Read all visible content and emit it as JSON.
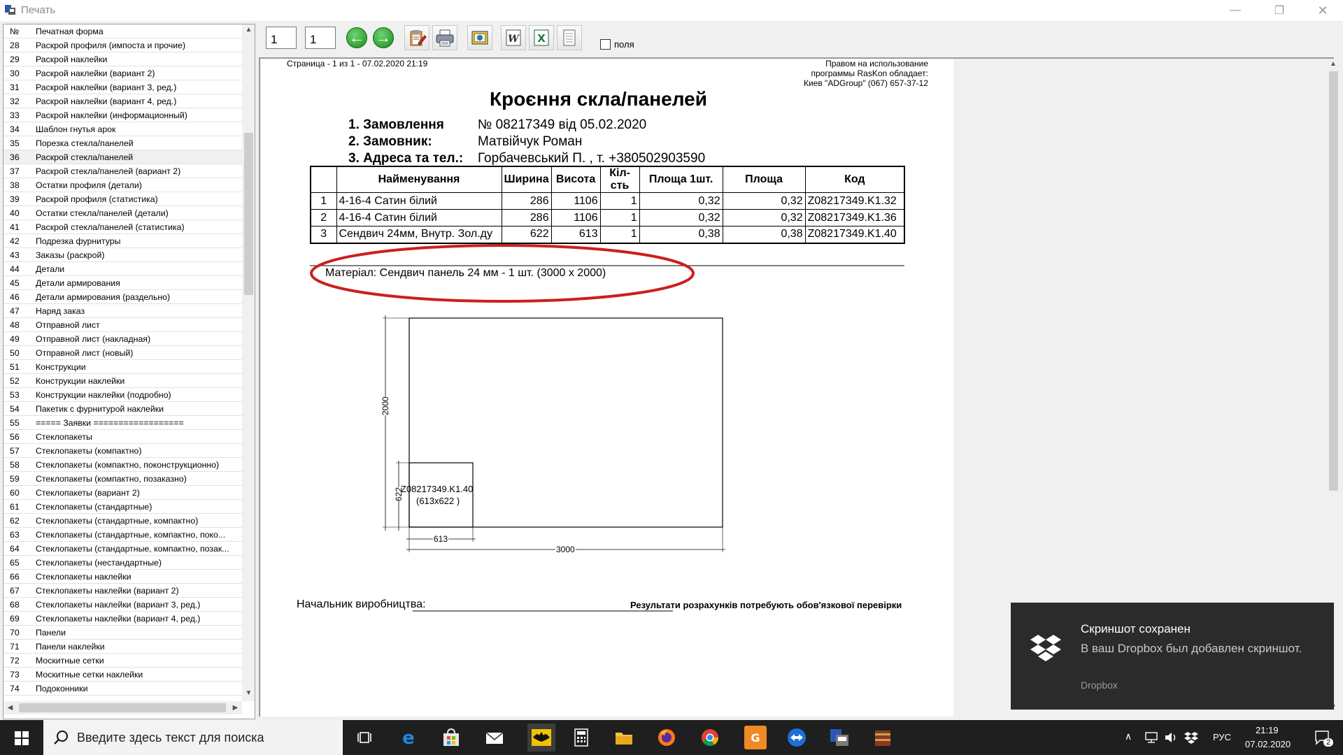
{
  "window": {
    "title": "Печать",
    "min": "—",
    "restore": "❐",
    "close": "✕"
  },
  "list": {
    "header": {
      "num": "№",
      "name": "Печатная форма"
    },
    "selected_index": 8,
    "rows": [
      {
        "n": "28",
        "name": "Раскрой профиля (импоста и прочие)"
      },
      {
        "n": "29",
        "name": "Раскрой наклейки"
      },
      {
        "n": "30",
        "name": "Раскрой наклейки (вариант 2)"
      },
      {
        "n": "31",
        "name": "Раскрой наклейки (вариант 3, ред.)"
      },
      {
        "n": "32",
        "name": "Раскрой наклейки (вариант 4, ред.)"
      },
      {
        "n": "33",
        "name": "Раскрой наклейки (информационный)"
      },
      {
        "n": "34",
        "name": "Шаблон гнутья арок"
      },
      {
        "n": "35",
        "name": "Порезка стекла/панелей"
      },
      {
        "n": "36",
        "name": "Раскрой стекла/панелей"
      },
      {
        "n": "37",
        "name": "Раскрой стекла/панелей (вариант 2)"
      },
      {
        "n": "38",
        "name": "Остатки профиля (детали)"
      },
      {
        "n": "39",
        "name": "Раскрой профиля (статистика)"
      },
      {
        "n": "40",
        "name": "Остатки стекла/панелей (детали)"
      },
      {
        "n": "41",
        "name": "Раскрой стекла/панелей (статистика)"
      },
      {
        "n": "42",
        "name": "Подрезка фурнитуры"
      },
      {
        "n": "43",
        "name": "Заказы (раскрой)"
      },
      {
        "n": "44",
        "name": "Детали"
      },
      {
        "n": "45",
        "name": "Детали армирования"
      },
      {
        "n": "46",
        "name": "Детали армирования (раздельно)"
      },
      {
        "n": "47",
        "name": "Наряд заказ"
      },
      {
        "n": "48",
        "name": "Отправной лист"
      },
      {
        "n": "49",
        "name": "Отправной лист (накладная)"
      },
      {
        "n": "50",
        "name": "Отправной лист (новый)"
      },
      {
        "n": "51",
        "name": "Конструкции"
      },
      {
        "n": "52",
        "name": "Конструкции наклейки"
      },
      {
        "n": "53",
        "name": "Конструкции наклейки (подробно)"
      },
      {
        "n": "54",
        "name": "Пакетик с фурнитурой наклейки"
      },
      {
        "n": "55",
        "name": "===== Заявки =================="
      },
      {
        "n": "56",
        "name": "Стеклопакеты"
      },
      {
        "n": "57",
        "name": "Стеклопакеты (компактно)"
      },
      {
        "n": "58",
        "name": "Стеклопакеты (компактно, поконструкционно)"
      },
      {
        "n": "59",
        "name": "Стеклопакеты (компактно, позаказно)"
      },
      {
        "n": "60",
        "name": "Стеклопакеты (вариант 2)"
      },
      {
        "n": "61",
        "name": "Стеклопакеты (стандартные)"
      },
      {
        "n": "62",
        "name": "Стеклопакеты (стандартные, компактно)"
      },
      {
        "n": "63",
        "name": "Стеклопакеты (стандартные, компактно, поко..."
      },
      {
        "n": "64",
        "name": "Стеклопакеты (стандартные, компактно, позак..."
      },
      {
        "n": "65",
        "name": "Стеклопакеты (нестандартные)"
      },
      {
        "n": "66",
        "name": "Стеклопакеты наклейки"
      },
      {
        "n": "67",
        "name": "Стеклопакеты наклейки (вариант 2)"
      },
      {
        "n": "68",
        "name": "Стеклопакеты наклейки (вариант 3, ред.)"
      },
      {
        "n": "69",
        "name": "Стеклопакеты наклейки (вариант 4, ред.)"
      },
      {
        "n": "70",
        "name": "Панели"
      },
      {
        "n": "71",
        "name": "Панели наклейки"
      },
      {
        "n": "72",
        "name": "Москитные сетки"
      },
      {
        "n": "73",
        "name": "Москитные сетки наклейки"
      },
      {
        "n": "74",
        "name": "Подоконники"
      }
    ]
  },
  "toolbar": {
    "page_from": "1",
    "page_to": "1",
    "fields_label": "поля"
  },
  "doc": {
    "page_info": "Страница  - 1 из 1 -  07.02.2020 21:19",
    "rights_line1": "Правом на использование",
    "rights_line2": "программы RasKon обладает:",
    "rights_line3": "Киев  \"ADGroup\"  (067) 657-37-12",
    "title": "Кроєння скла/панелей",
    "order_label": "1. Замовлення",
    "order_value": "№ 08217349  від 05.02.2020",
    "customer_label": "2. Замовник:",
    "customer_value": "Матвійчук Роман",
    "address_label": "3. Адреса та тел.:",
    "address_value": "Горбачевський П. , т. +380502903590",
    "table": {
      "headers": [
        "",
        "Найменування",
        "Ширина",
        "Висота",
        "Кіл-сть",
        "Площа 1шт.",
        "Площа",
        "Код"
      ],
      "rows": [
        [
          "1",
          "4-16-4 Сатин білий",
          "286",
          "1106",
          "1",
          "0,32",
          "0,32",
          "Z08217349.K1.32"
        ],
        [
          "2",
          "4-16-4 Сатин білий",
          "286",
          "1106",
          "1",
          "0,32",
          "0,32",
          "Z08217349.K1.36"
        ],
        [
          "3",
          "Сендвич 24мм, Внутр. Зол.ду",
          "622",
          "613",
          "1",
          "0,38",
          "0,38",
          "Z08217349.K1.40"
        ]
      ]
    },
    "material": "Матеріал: Сендвич панель 24 мм   - 1 шт. (3000 x 2000)",
    "sheet_width": "3000",
    "sheet_height": "2000",
    "piece_code": "Z08217349.K1.40",
    "piece_size": "(613x622 )",
    "piece_width": "613",
    "piece_height": "622",
    "signature_label": "Начальник виробництва:",
    "disclaimer": "Результати розрахунків потребують обов'язкової перевірки"
  },
  "toast": {
    "title": "Скриншот сохранен",
    "body": "В ваш Dropbox был добавлен скриншот.",
    "source": "Dropbox"
  },
  "taskbar": {
    "search_placeholder": "Введите здесь текст для поиска",
    "lang": "РУС",
    "time": "21:19",
    "date": "07.02.2020",
    "notif_count": "2"
  },
  "colors": {
    "highlight_ellipse": "#cc1f1f",
    "toast_bg": "#2b2b2b",
    "taskbar_bg": "#1f1f1f"
  }
}
